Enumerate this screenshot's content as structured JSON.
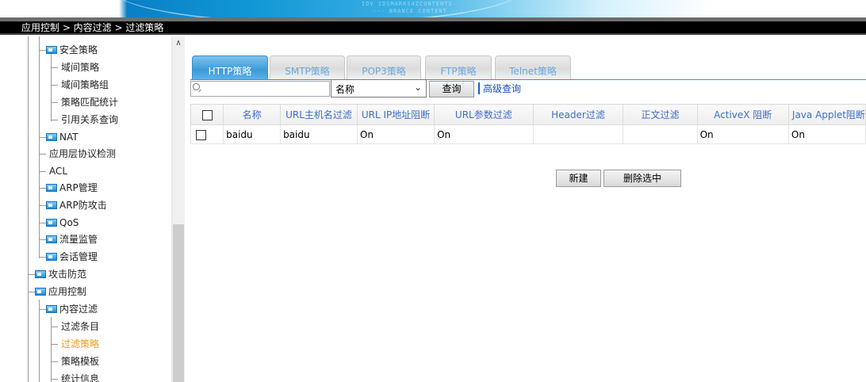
{
  "banner": {
    "watermark_line1": "IDV IDSMARKS4ZCONTENTS",
    "watermark_line2": "--- BRANCE CONTENT ---"
  },
  "breadcrumb": {
    "text": "应用控制 > 内容过滤 > 过滤策略"
  },
  "nav": {
    "scroll_up_icon": "chevron-up-icon",
    "items": [
      {
        "label": "安全策略",
        "icon": "folder-icon"
      },
      {
        "label": "域间策略"
      },
      {
        "label": "域间策略组"
      },
      {
        "label": "策略匹配统计"
      },
      {
        "label": "引用关系查询"
      },
      {
        "label": "NAT",
        "icon": "folder-icon"
      },
      {
        "label": "应用层协议检测"
      },
      {
        "label": "ACL"
      },
      {
        "label": "ARP管理",
        "icon": "folder-icon"
      },
      {
        "label": "ARP防攻击",
        "icon": "folder-icon"
      },
      {
        "label": "QoS",
        "icon": "folder-icon"
      },
      {
        "label": "流量监管",
        "icon": "folder-icon"
      },
      {
        "label": "会话管理",
        "icon": "folder-icon"
      },
      {
        "label": "攻击防范",
        "icon": "folder-icon"
      },
      {
        "label": "应用控制",
        "icon": "folder-icon"
      },
      {
        "label": "内容过滤",
        "icon": "folder-icon"
      },
      {
        "label": "过滤条目"
      },
      {
        "label": "过滤策略",
        "active": true
      },
      {
        "label": "策略模板"
      },
      {
        "label": "统计信息"
      }
    ]
  },
  "tabs": [
    {
      "label": "HTTP策略",
      "active": true
    },
    {
      "label": "SMTP策略"
    },
    {
      "label": "POP3策略"
    },
    {
      "label": "FTP策略"
    },
    {
      "label": "Telnet策略"
    }
  ],
  "search": {
    "value": "",
    "placeholder": "",
    "field_selected": "名称",
    "query_button": "查询",
    "advanced_link": "高级查询"
  },
  "table": {
    "headers": [
      "名称",
      "URL主机名过滤",
      "URL IP地址阻断",
      "URL参数过滤",
      "Header过滤",
      "正文过滤",
      "ActiveX 阻断",
      "Java Applet阻断"
    ],
    "rows": [
      {
        "cells": [
          "baidu",
          "baidu",
          "On",
          "On",
          "",
          "",
          "On",
          "On"
        ]
      }
    ]
  },
  "actions": {
    "new_button": "新建",
    "delete_button": "删除选中"
  },
  "colors": {
    "tab_active": "#3c9ad8",
    "tab_inactive_text": "#6ea6d8",
    "header_text": "#3e6fc6",
    "nav_active": "#f19a1a",
    "link": "#1b4fb8"
  }
}
